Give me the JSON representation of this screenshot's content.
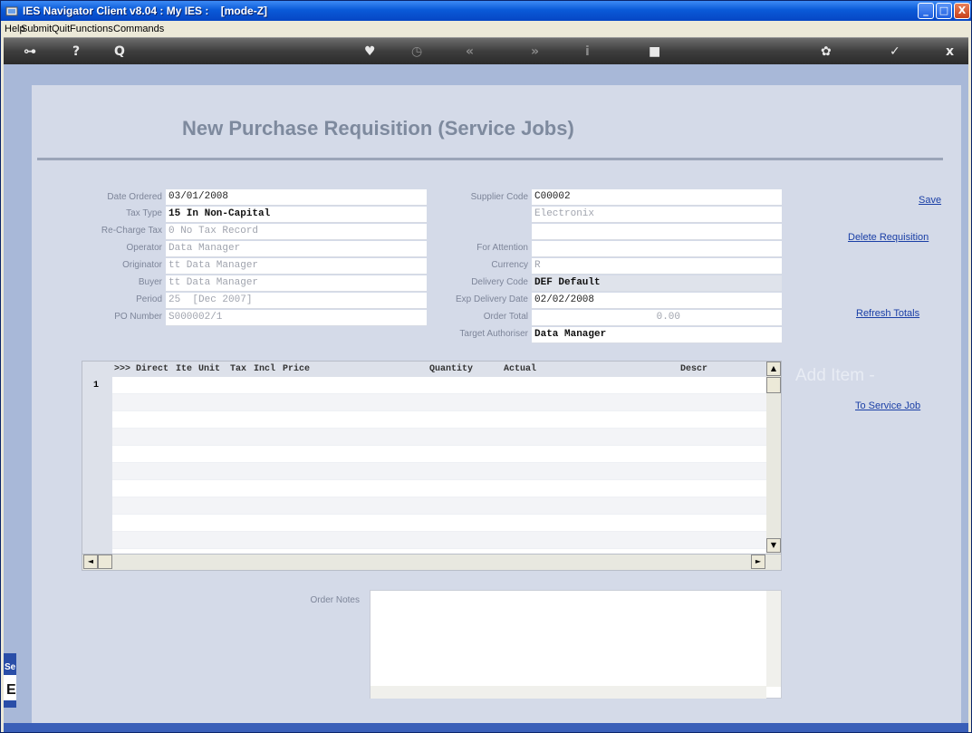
{
  "window": {
    "title": "IES Navigator Client v8.04 : My IES :    [mode-Z]",
    "controls": {
      "minimize": "_",
      "maximize": "□",
      "close": "X"
    }
  },
  "menu": [
    "Help",
    "Submit",
    "Quit",
    "Functions",
    "Commands"
  ],
  "toolbar": {
    "icons": [
      "key-icon",
      "help-icon",
      "search-icon",
      "heart-icon",
      "clock-icon",
      "back-icon",
      "forward-icon",
      "info-icon",
      "stop-icon",
      "settings-icon",
      "check-icon",
      "close-icon"
    ],
    "glyphs": {
      "key": "⊶",
      "help": "?",
      "search": "Q",
      "heart": "♥",
      "clock": "◷",
      "back": "«",
      "forward": "»",
      "info": "i",
      "stop": "■",
      "settings": "✿",
      "check": "✓",
      "close": "x"
    }
  },
  "form": {
    "title": "New Purchase Requisition (Service Jobs)",
    "left_fields": [
      {
        "label": "Date Ordered",
        "value": "03/01/2008"
      },
      {
        "label": "Tax Type",
        "value": "15 In Non-Capital"
      },
      {
        "label": "Re-Charge Tax",
        "value": "0 No Tax Record"
      },
      {
        "label": "Operator",
        "value": "Data Manager"
      },
      {
        "label": "Originator",
        "value": "tt Data Manager"
      },
      {
        "label": "Buyer",
        "value": "tt Data Manager"
      },
      {
        "label": "Period",
        "value": "25  [Dec 2007]"
      },
      {
        "label": "PO Number",
        "value": "S000002/1"
      }
    ],
    "right_fields": [
      {
        "label": "Supplier Code",
        "value": "C00002"
      },
      {
        "label": "",
        "value": "Electronix"
      },
      {
        "label": "For Attention",
        "value": ""
      },
      {
        "label": "Currency",
        "value": "R"
      },
      {
        "label": "Delivery Code",
        "value": "DEF Default"
      },
      {
        "label": "Exp Delivery Date",
        "value": "02/02/2008"
      },
      {
        "label": "Order Total",
        "value": "0.00"
      },
      {
        "label": "Target Authoriser",
        "value": "Data Manager"
      }
    ],
    "actions": {
      "save": "Save",
      "delete": "Delete Requisition",
      "refresh": "Refresh Totals",
      "to_service_job": "To Service Job"
    },
    "add_item": "Add Item -",
    "order_notes_label": "Order Notes",
    "order_notes_value": ""
  },
  "grid": {
    "columns": [
      ">>>",
      "Direct",
      "Ite",
      "Unit",
      "Tax",
      "Incl",
      "Price",
      "Quantity",
      "Actual",
      "Descr"
    ],
    "row_numbers": [
      "1"
    ],
    "scroll": {
      "up": "▲",
      "down": "▼",
      "left": "◄",
      "right": "►"
    }
  },
  "side_panel": {
    "text": "Se",
    "letter": "E"
  }
}
